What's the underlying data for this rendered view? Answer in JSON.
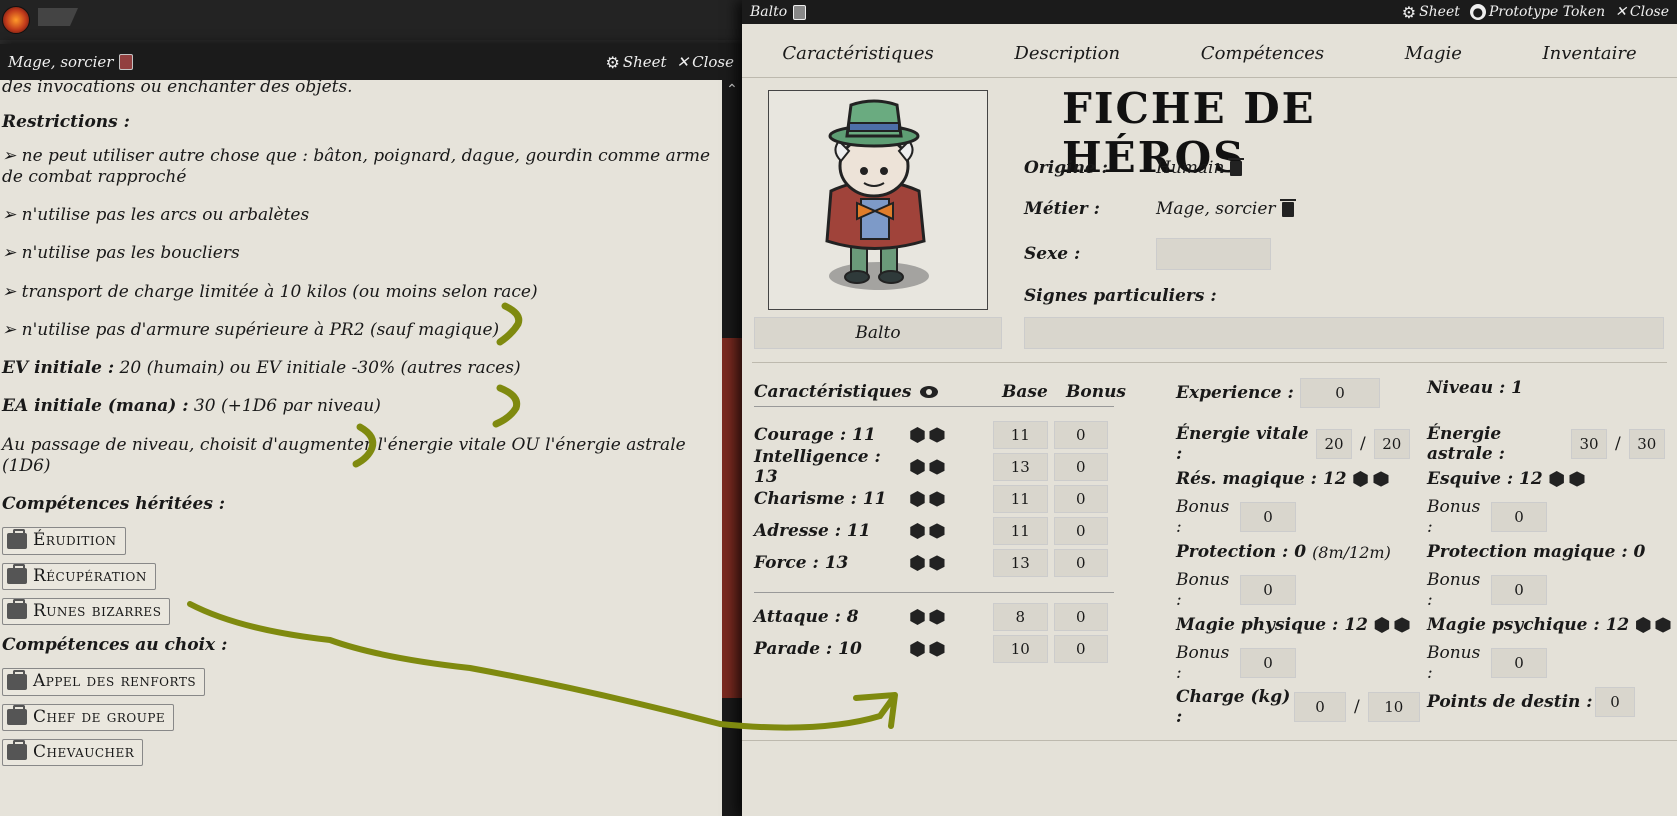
{
  "left_window": {
    "title": "Mage, sorcier",
    "sheet_label": "Sheet",
    "close_label": "Close",
    "intro_text": "des invocations ou enchanter des objets.",
    "restrictions_heading": "Restrictions :",
    "restrictions": [
      "➢ ne peut utiliser autre chose que : bâton, poignard, dague, gourdin comme arme de combat rapproché",
      "➢ n'utilise pas les arcs ou arbalètes",
      "➢ n'utilise pas les boucliers",
      "➢ transport de charge limitée à 10 kilos (ou moins selon race)",
      "➢ n'utilise pas d'armure supérieure à PR2 (sauf magique)"
    ],
    "ev_label": "EV initiale :",
    "ev_text": " 20 (humain) ou EV initiale -30% (autres races)",
    "ea_label": "EA initiale (mana) :",
    "ea_text": " 30 (+1D6 par niveau)",
    "level_up_text": "Au passage de niveau, choisit d'augmenter l'énergie vitale OU l'énergie astrale (1D6)",
    "inherited_heading": "Compétences héritées :",
    "inherited_skills": [
      "Érudition",
      "Récupération",
      "Runes bizarres"
    ],
    "choice_heading": "Compétences au choix :",
    "choice_skills": [
      "Appel des renforts",
      "Chef de groupe",
      "Chevaucher"
    ]
  },
  "right_window": {
    "title": "Balto",
    "sheet_label": "Sheet",
    "prototype_label": "Prototype Token",
    "close_label": "Close",
    "tabs": [
      "Caractéristiques",
      "Description",
      "Compétences",
      "Magie",
      "Inventaire"
    ],
    "sheet_title": "FICHE DE HÉROS",
    "token_name": "Balto",
    "origine_label": "Origine :",
    "origine_value": "Humain",
    "metier_label": "Métier :",
    "metier_value": "Mage, sorcier",
    "sexe_label": "Sexe :",
    "signes_label": "Signes particuliers :",
    "char_header": "Caractéristiques",
    "base_header": "Base",
    "bonus_header": "Bonus",
    "characteristics": [
      {
        "label": "Courage : 11",
        "base": "11",
        "bonus": "0"
      },
      {
        "label": "Intelligence : 13",
        "base": "13",
        "bonus": "0"
      },
      {
        "label": "Charisme : 11",
        "base": "11",
        "bonus": "0"
      },
      {
        "label": "Adresse : 11",
        "base": "11",
        "bonus": "0"
      },
      {
        "label": "Force : 13",
        "base": "13",
        "bonus": "0"
      }
    ],
    "combat": [
      {
        "label": "Attaque : 8",
        "base": "8",
        "bonus": "0"
      },
      {
        "label": "Parade : 10",
        "base": "10",
        "bonus": "0"
      }
    ],
    "experience_label": "Experience :",
    "experience_value": "0",
    "niveau_label": "Niveau : 1",
    "energie_vitale_label": "Énergie vitale :",
    "ev_current": "20",
    "ev_max": "20",
    "energie_astrale_label": "Énergie astrale :",
    "ea_current": "30",
    "ea_max": "30",
    "res_magique_label": "Rés. magique : 12",
    "res_magique_bonus": "0",
    "esquive_label": "Esquive : 12",
    "esquive_bonus": "0",
    "protection_label": "Protection : 0",
    "protection_note": "(8m/12m)",
    "protection_bonus": "0",
    "protection_magique_label": "Protection magique : 0",
    "protection_magique_bonus": "0",
    "magie_physique_label": "Magie physique : 12",
    "magie_physique_bonus": "0",
    "magie_psychique_label": "Magie psychique : 12",
    "magie_psychique_bonus": "0",
    "charge_label": "Charge (kg) :",
    "charge_current": "0",
    "charge_max": "10",
    "destin_label": "Points de destin :",
    "destin_value": "0",
    "bonus_label": "Bonus :"
  },
  "colors": {
    "parchment": "#e6e3da",
    "header_dark": "#1b1b1b",
    "scroll_thumb": "#7a2a20",
    "annotation": "#7f8a0f"
  }
}
